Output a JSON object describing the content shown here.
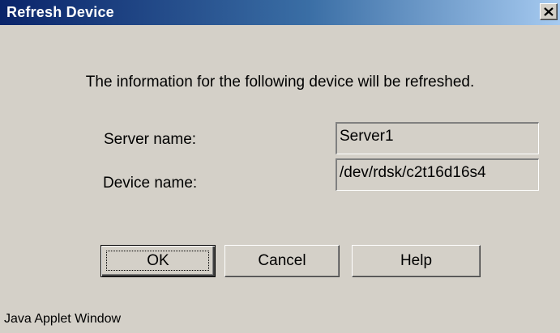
{
  "window": {
    "title": "Refresh Device",
    "close_symbol": "×"
  },
  "message": "The information for the following device will be refreshed.",
  "fields": {
    "server": {
      "label": "Server name:",
      "value": "Server1"
    },
    "device": {
      "label": "Device name:",
      "value": "/dev/rdsk/c2t16d16s4"
    }
  },
  "buttons": {
    "ok": "OK",
    "cancel": "Cancel",
    "help": "Help"
  },
  "status_text": "Java Applet Window",
  "colors": {
    "dialog_bg": "#d4d0c8",
    "titlebar_start": "#0a246a",
    "titlebar_end": "#a6caf0",
    "title_text": "#ffffff"
  },
  "icons": {
    "close": "close-icon"
  }
}
